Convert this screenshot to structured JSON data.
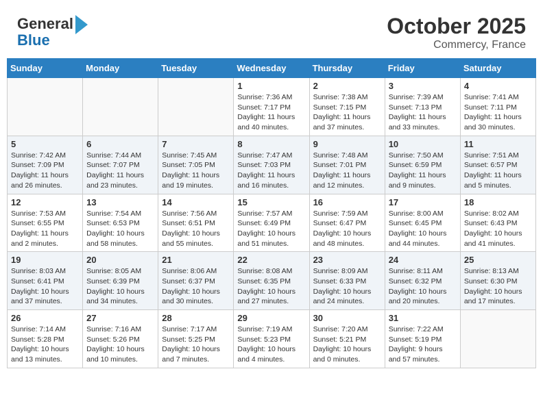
{
  "header": {
    "logo_line1": "General",
    "logo_line2": "Blue",
    "month": "October 2025",
    "location": "Commercy, France"
  },
  "weekdays": [
    "Sunday",
    "Monday",
    "Tuesday",
    "Wednesday",
    "Thursday",
    "Friday",
    "Saturday"
  ],
  "weeks": [
    [
      {
        "day": "",
        "info": ""
      },
      {
        "day": "",
        "info": ""
      },
      {
        "day": "",
        "info": ""
      },
      {
        "day": "1",
        "info": "Sunrise: 7:36 AM\nSunset: 7:17 PM\nDaylight: 11 hours and 40 minutes."
      },
      {
        "day": "2",
        "info": "Sunrise: 7:38 AM\nSunset: 7:15 PM\nDaylight: 11 hours and 37 minutes."
      },
      {
        "day": "3",
        "info": "Sunrise: 7:39 AM\nSunset: 7:13 PM\nDaylight: 11 hours and 33 minutes."
      },
      {
        "day": "4",
        "info": "Sunrise: 7:41 AM\nSunset: 7:11 PM\nDaylight: 11 hours and 30 minutes."
      }
    ],
    [
      {
        "day": "5",
        "info": "Sunrise: 7:42 AM\nSunset: 7:09 PM\nDaylight: 11 hours and 26 minutes."
      },
      {
        "day": "6",
        "info": "Sunrise: 7:44 AM\nSunset: 7:07 PM\nDaylight: 11 hours and 23 minutes."
      },
      {
        "day": "7",
        "info": "Sunrise: 7:45 AM\nSunset: 7:05 PM\nDaylight: 11 hours and 19 minutes."
      },
      {
        "day": "8",
        "info": "Sunrise: 7:47 AM\nSunset: 7:03 PM\nDaylight: 11 hours and 16 minutes."
      },
      {
        "day": "9",
        "info": "Sunrise: 7:48 AM\nSunset: 7:01 PM\nDaylight: 11 hours and 12 minutes."
      },
      {
        "day": "10",
        "info": "Sunrise: 7:50 AM\nSunset: 6:59 PM\nDaylight: 11 hours and 9 minutes."
      },
      {
        "day": "11",
        "info": "Sunrise: 7:51 AM\nSunset: 6:57 PM\nDaylight: 11 hours and 5 minutes."
      }
    ],
    [
      {
        "day": "12",
        "info": "Sunrise: 7:53 AM\nSunset: 6:55 PM\nDaylight: 11 hours and 2 minutes."
      },
      {
        "day": "13",
        "info": "Sunrise: 7:54 AM\nSunset: 6:53 PM\nDaylight: 10 hours and 58 minutes."
      },
      {
        "day": "14",
        "info": "Sunrise: 7:56 AM\nSunset: 6:51 PM\nDaylight: 10 hours and 55 minutes."
      },
      {
        "day": "15",
        "info": "Sunrise: 7:57 AM\nSunset: 6:49 PM\nDaylight: 10 hours and 51 minutes."
      },
      {
        "day": "16",
        "info": "Sunrise: 7:59 AM\nSunset: 6:47 PM\nDaylight: 10 hours and 48 minutes."
      },
      {
        "day": "17",
        "info": "Sunrise: 8:00 AM\nSunset: 6:45 PM\nDaylight: 10 hours and 44 minutes."
      },
      {
        "day": "18",
        "info": "Sunrise: 8:02 AM\nSunset: 6:43 PM\nDaylight: 10 hours and 41 minutes."
      }
    ],
    [
      {
        "day": "19",
        "info": "Sunrise: 8:03 AM\nSunset: 6:41 PM\nDaylight: 10 hours and 37 minutes."
      },
      {
        "day": "20",
        "info": "Sunrise: 8:05 AM\nSunset: 6:39 PM\nDaylight: 10 hours and 34 minutes."
      },
      {
        "day": "21",
        "info": "Sunrise: 8:06 AM\nSunset: 6:37 PM\nDaylight: 10 hours and 30 minutes."
      },
      {
        "day": "22",
        "info": "Sunrise: 8:08 AM\nSunset: 6:35 PM\nDaylight: 10 hours and 27 minutes."
      },
      {
        "day": "23",
        "info": "Sunrise: 8:09 AM\nSunset: 6:33 PM\nDaylight: 10 hours and 24 minutes."
      },
      {
        "day": "24",
        "info": "Sunrise: 8:11 AM\nSunset: 6:32 PM\nDaylight: 10 hours and 20 minutes."
      },
      {
        "day": "25",
        "info": "Sunrise: 8:13 AM\nSunset: 6:30 PM\nDaylight: 10 hours and 17 minutes."
      }
    ],
    [
      {
        "day": "26",
        "info": "Sunrise: 7:14 AM\nSunset: 5:28 PM\nDaylight: 10 hours and 13 minutes."
      },
      {
        "day": "27",
        "info": "Sunrise: 7:16 AM\nSunset: 5:26 PM\nDaylight: 10 hours and 10 minutes."
      },
      {
        "day": "28",
        "info": "Sunrise: 7:17 AM\nSunset: 5:25 PM\nDaylight: 10 hours and 7 minutes."
      },
      {
        "day": "29",
        "info": "Sunrise: 7:19 AM\nSunset: 5:23 PM\nDaylight: 10 hours and 4 minutes."
      },
      {
        "day": "30",
        "info": "Sunrise: 7:20 AM\nSunset: 5:21 PM\nDaylight: 10 hours and 0 minutes."
      },
      {
        "day": "31",
        "info": "Sunrise: 7:22 AM\nSunset: 5:19 PM\nDaylight: 9 hours and 57 minutes."
      },
      {
        "day": "",
        "info": ""
      }
    ]
  ]
}
